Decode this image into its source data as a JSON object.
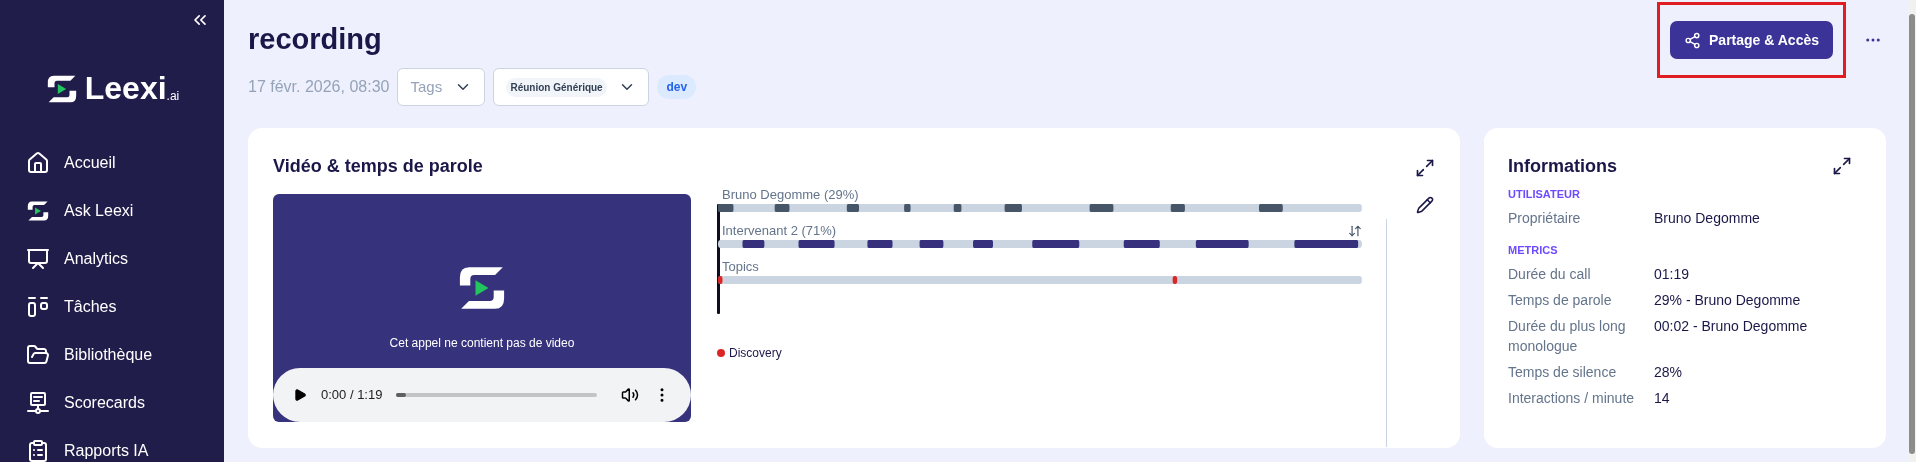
{
  "sidebar": {
    "logo": {
      "name": "Leexi",
      "suffix": ".ai"
    },
    "items": [
      {
        "label": "Accueil"
      },
      {
        "label": "Ask Leexi"
      },
      {
        "label": "Analytics"
      },
      {
        "label": "Tâches"
      },
      {
        "label": "Bibliothèque"
      },
      {
        "label": "Scorecards"
      },
      {
        "label": "Rapports IA"
      }
    ]
  },
  "header": {
    "title": "recording",
    "date": "17 févr. 2026, 08:30",
    "tags_select": {
      "placeholder": "Tags"
    },
    "type_select": {
      "value": "Réunion Générique"
    },
    "badge": "dev",
    "share_button": "Partage & Accès",
    "highlighted": true
  },
  "video_card": {
    "title": "Vidéo & temps de parole",
    "no_video_message": "Cet appel ne contient pas de video",
    "player": {
      "time": "0:00 / 1:19",
      "level": 0.05
    },
    "tracks": [
      {
        "label": "Bruno Degomme (29%)",
        "kind": "speaker",
        "sortable": false
      },
      {
        "label": "Intervenant 2 (71%)",
        "kind": "speaker",
        "sortable": true
      },
      {
        "label": "Topics",
        "kind": "topics",
        "sortable": false
      }
    ],
    "legend": [
      {
        "label": "Discovery",
        "color": "#dc2626"
      }
    ]
  },
  "info_card": {
    "title": "Informations",
    "sections": [
      {
        "heading": "UTILISATEUR",
        "rows": [
          {
            "label": "Propriétaire",
            "value": "Bruno Degomme"
          }
        ]
      },
      {
        "heading": "METRICS",
        "rows": [
          {
            "label": "Durée du call",
            "value": "01:19"
          },
          {
            "label": "Temps de parole",
            "value": "29% - Bruno Degomme"
          },
          {
            "label": "Durée du plus long monologue",
            "value": "00:02 - Bruno Degomme"
          },
          {
            "label": "Temps de silence",
            "value": "28%"
          },
          {
            "label": "Interactions / minute",
            "value": "14"
          }
        ]
      }
    ]
  }
}
